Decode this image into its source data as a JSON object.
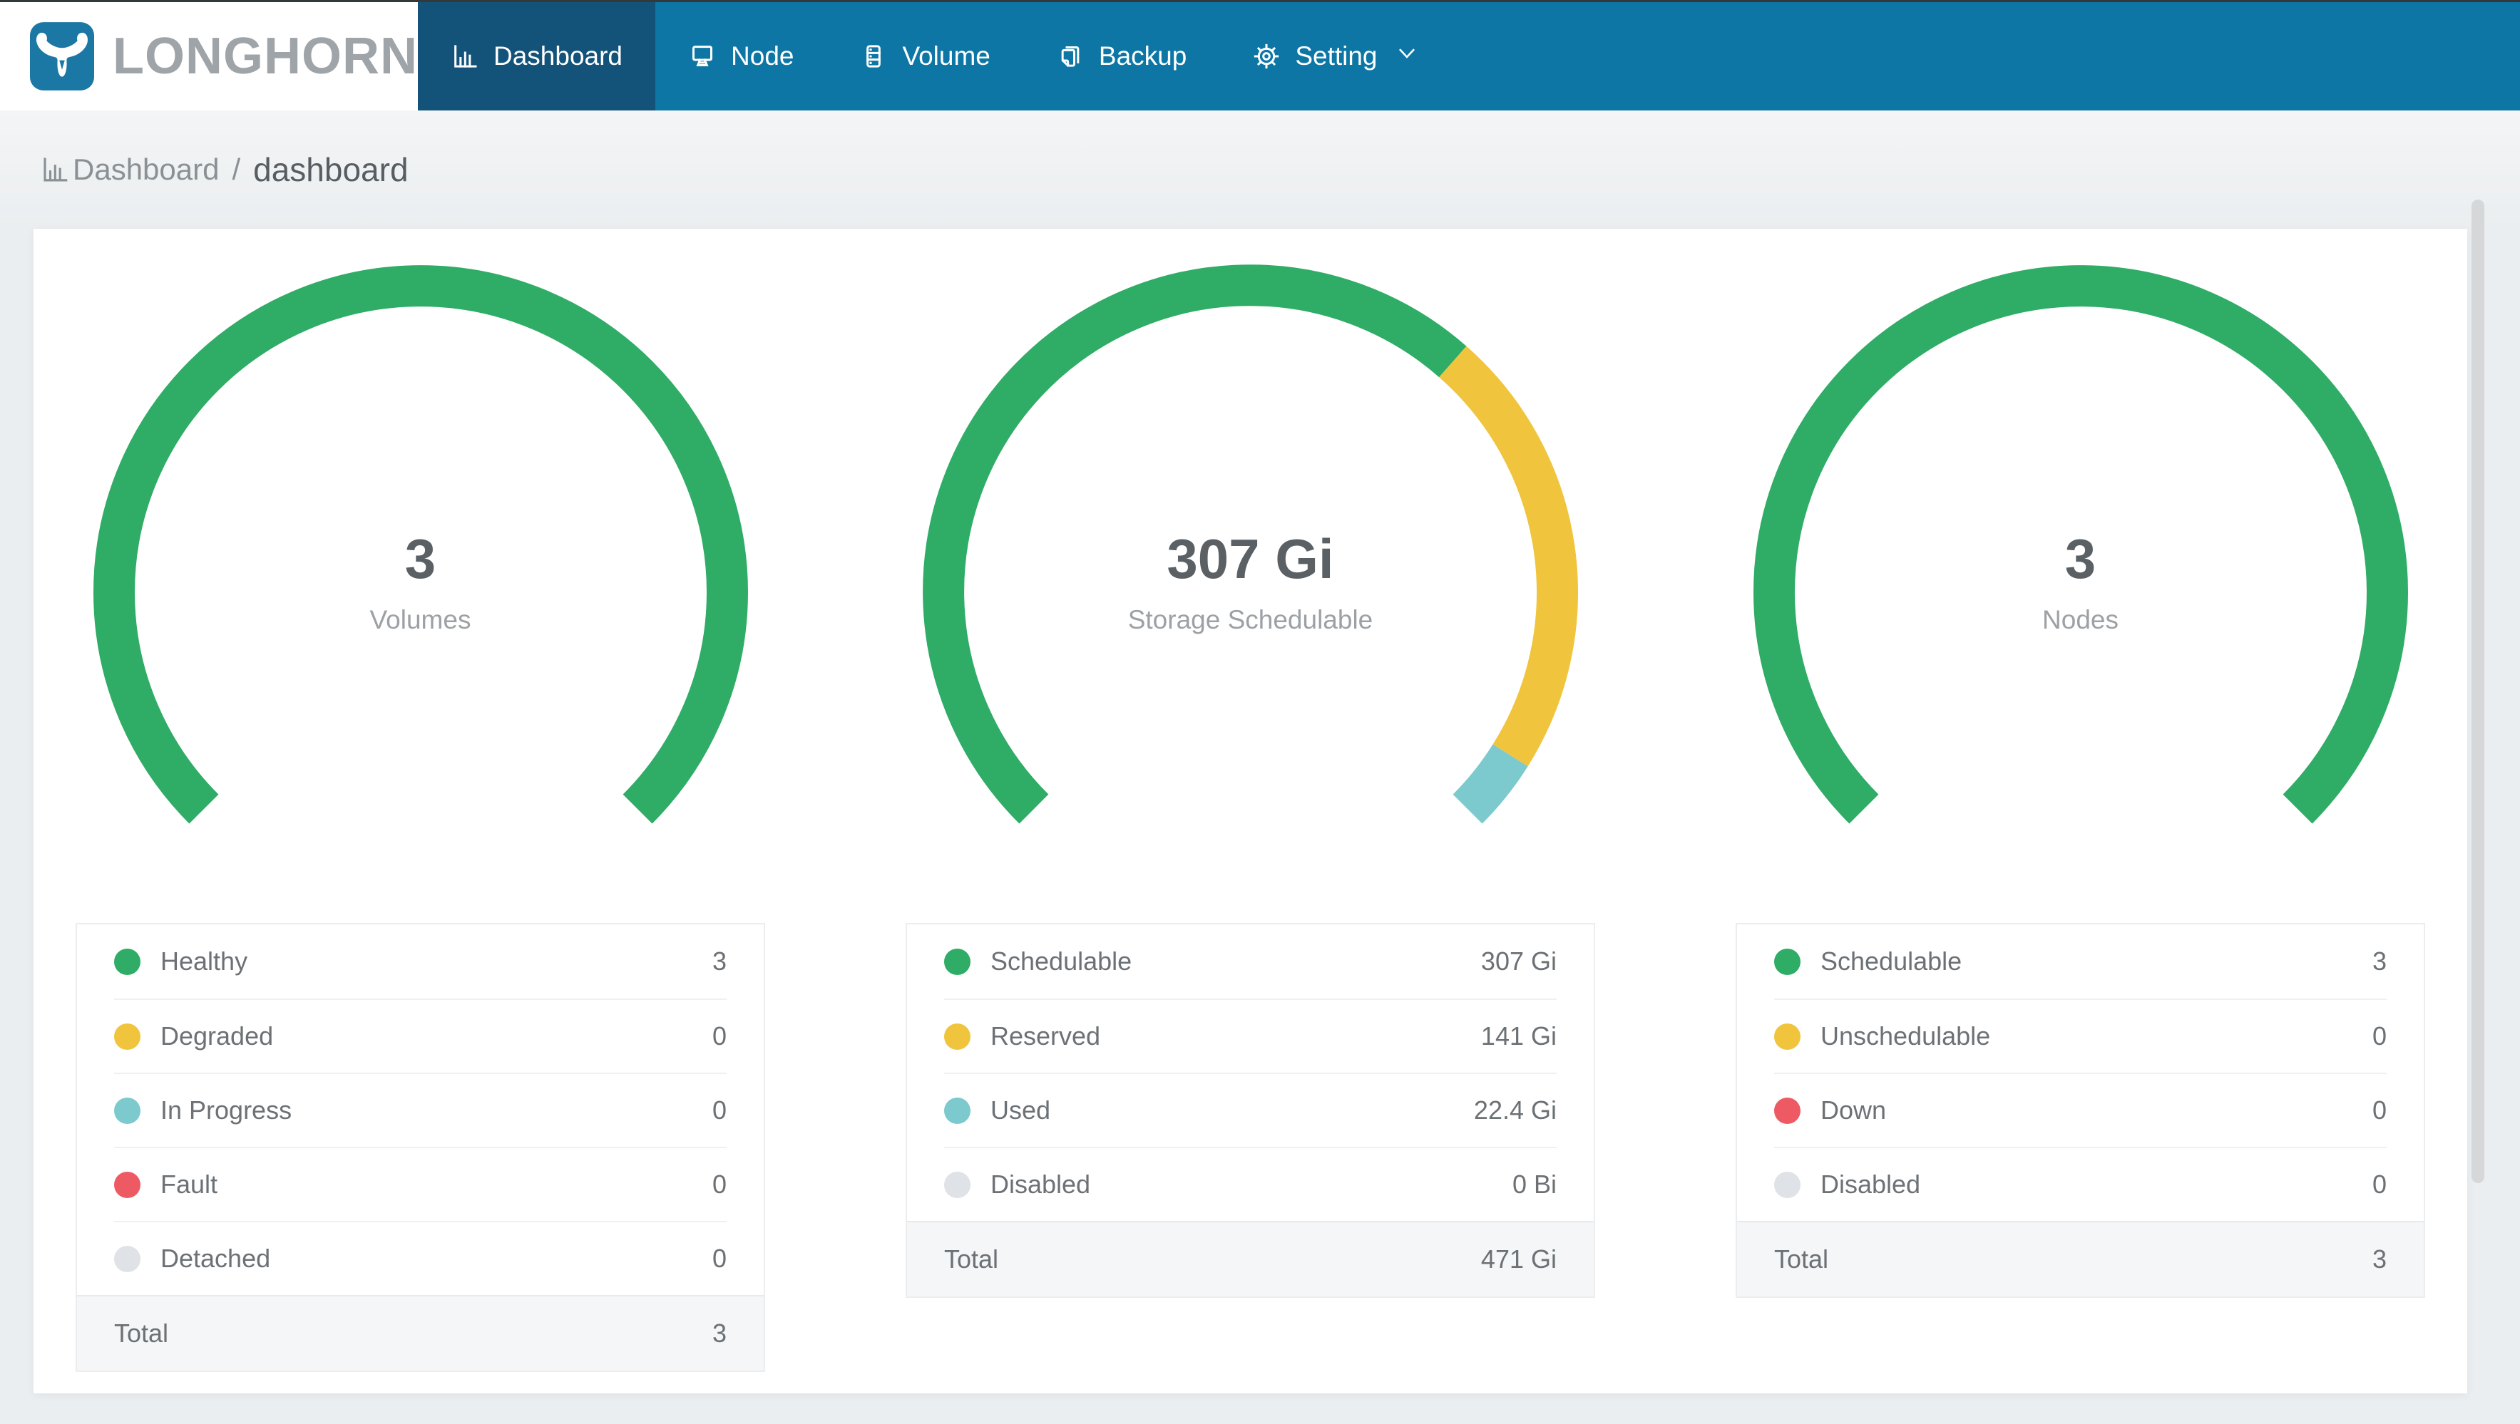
{
  "brand": {
    "name": "LONGHORN",
    "logo_icon": "longhorn-bull-icon"
  },
  "nav": {
    "items": [
      {
        "label": "Dashboard",
        "icon": "bar-chart-icon",
        "active": true
      },
      {
        "label": "Node",
        "icon": "monitor-icon",
        "active": false
      },
      {
        "label": "Volume",
        "icon": "database-icon",
        "active": false
      },
      {
        "label": "Backup",
        "icon": "copy-icon",
        "active": false
      },
      {
        "label": "Setting",
        "icon": "gear-icon",
        "active": false,
        "has_dropdown": true
      }
    ]
  },
  "breadcrumb": {
    "section": "Dashboard",
    "separator": "/",
    "page": "dashboard",
    "icon": "bar-chart-icon"
  },
  "palette": {
    "navbar_bg": "#0D76A5",
    "navbar_active_bg": "#13537A",
    "logo_blue": "#1B77A4",
    "green": "#2FAC66",
    "yellow": "#F0C53D",
    "teal": "#7CC9CE",
    "red": "#EE5A64",
    "gray": "#DFE2E6",
    "page_bg": "#EBEEF0",
    "card_bg": "#FFFFFF"
  },
  "columns": [
    {
      "gauge": {
        "center_value": "3",
        "center_label": "Volumes"
      },
      "rows": [
        {
          "label": "Healthy",
          "value": "3",
          "color": "#2FAC66"
        },
        {
          "label": "Degraded",
          "value": "0",
          "color": "#F0C53D"
        },
        {
          "label": "In Progress",
          "value": "0",
          "color": "#7CC9CE"
        },
        {
          "label": "Fault",
          "value": "0",
          "color": "#EE5A64"
        },
        {
          "label": "Detached",
          "value": "0",
          "color": "#DFE2E6"
        }
      ],
      "total": {
        "label": "Total",
        "value": "3"
      }
    },
    {
      "gauge": {
        "center_value": "307 Gi",
        "center_label": "Storage Schedulable"
      },
      "rows": [
        {
          "label": "Schedulable",
          "value": "307 Gi",
          "color": "#2FAC66"
        },
        {
          "label": "Reserved",
          "value": "141 Gi",
          "color": "#F0C53D"
        },
        {
          "label": "Used",
          "value": "22.4 Gi",
          "color": "#7CC9CE"
        },
        {
          "label": "Disabled",
          "value": "0 Bi",
          "color": "#DFE2E6"
        }
      ],
      "total": {
        "label": "Total",
        "value": "471 Gi"
      }
    },
    {
      "gauge": {
        "center_value": "3",
        "center_label": "Nodes"
      },
      "rows": [
        {
          "label": "Schedulable",
          "value": "3",
          "color": "#2FAC66"
        },
        {
          "label": "Unschedulable",
          "value": "0",
          "color": "#F0C53D"
        },
        {
          "label": "Down",
          "value": "0",
          "color": "#EE5A64"
        },
        {
          "label": "Disabled",
          "value": "0",
          "color": "#DFE2E6"
        }
      ],
      "total": {
        "label": "Total",
        "value": "3"
      }
    }
  ],
  "chart_data": [
    {
      "type": "gauge",
      "title": "Volumes",
      "center_value": "3",
      "arc_degrees": 270,
      "segments": [
        {
          "label": "Healthy",
          "value": 3,
          "color": "#2FAC66"
        },
        {
          "label": "Degraded",
          "value": 0,
          "color": "#F0C53D"
        },
        {
          "label": "In Progress",
          "value": 0,
          "color": "#7CC9CE"
        },
        {
          "label": "Fault",
          "value": 0,
          "color": "#EE5A64"
        },
        {
          "label": "Detached",
          "value": 0,
          "color": "#DFE2E6"
        }
      ],
      "total": 3
    },
    {
      "type": "gauge",
      "title": "Storage Schedulable",
      "center_value": "307 Gi",
      "arc_degrees": 270,
      "segments": [
        {
          "label": "Schedulable",
          "value": 307,
          "color": "#2FAC66"
        },
        {
          "label": "Reserved",
          "value": 141,
          "color": "#F0C53D"
        },
        {
          "label": "Used",
          "value": 22.4,
          "color": "#7CC9CE"
        },
        {
          "label": "Disabled",
          "value": 0,
          "color": "#DFE2E6"
        }
      ],
      "total": 470.4,
      "total_label": "471 Gi"
    },
    {
      "type": "gauge",
      "title": "Nodes",
      "center_value": "3",
      "arc_degrees": 270,
      "segments": [
        {
          "label": "Schedulable",
          "value": 3,
          "color": "#2FAC66"
        },
        {
          "label": "Unschedulable",
          "value": 0,
          "color": "#F0C53D"
        },
        {
          "label": "Down",
          "value": 0,
          "color": "#EE5A64"
        },
        {
          "label": "Disabled",
          "value": 0,
          "color": "#DFE2E6"
        }
      ],
      "total": 3
    }
  ]
}
